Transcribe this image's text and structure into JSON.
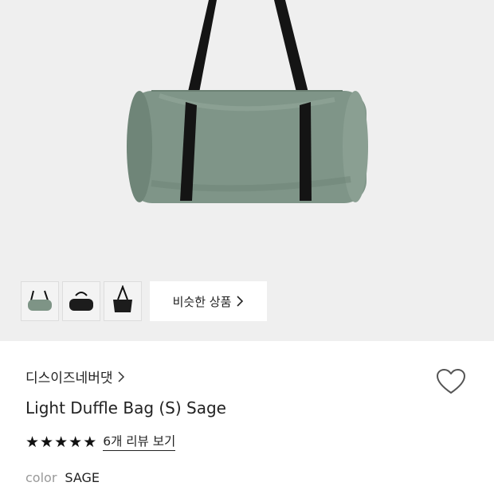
{
  "similar": {
    "label": "비슷한 상품"
  },
  "product": {
    "brand": "디스이즈네버댓",
    "title": "Light Duffle Bag (S) Sage",
    "rating": 5,
    "review_link": "6개 리뷰 보기",
    "option_label": "color",
    "option_value": "SAGE"
  },
  "thumbnails": [
    {
      "color": "#7e9486"
    },
    {
      "color": "#1c1c1c"
    },
    {
      "color": "#1c1c1c"
    }
  ],
  "colors": {
    "bag_body": "#7f9588",
    "strap": "#141414",
    "hero_bg": "#efefef"
  },
  "icons": [
    "chevron-right-icon",
    "heart-icon",
    "star-icon"
  ]
}
